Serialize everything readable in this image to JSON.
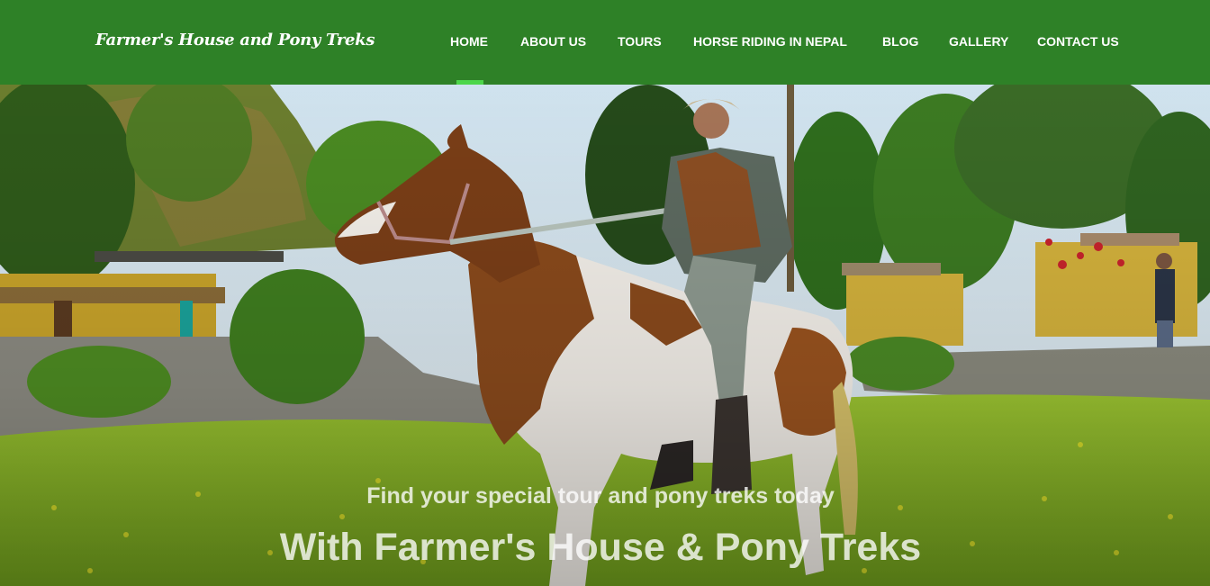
{
  "brand": {
    "name": "Farmer's House and Pony Treks"
  },
  "nav": {
    "items": [
      {
        "label": "HOME",
        "active": true
      },
      {
        "label": "ABOUT US"
      },
      {
        "label": "TOURS"
      },
      {
        "label": "HORSE RIDING IN NEPAL"
      },
      {
        "label": "BLOG"
      },
      {
        "label": "GALLERY"
      },
      {
        "label": "CONTACT US"
      }
    ]
  },
  "hero": {
    "subtitle": "Find your special tour and pony treks today",
    "title": "With Farmer's House & Pony Treks"
  },
  "colors": {
    "navbar": "#2e8127",
    "active_indicator": "#4cd64a",
    "text": "#ffffff"
  }
}
